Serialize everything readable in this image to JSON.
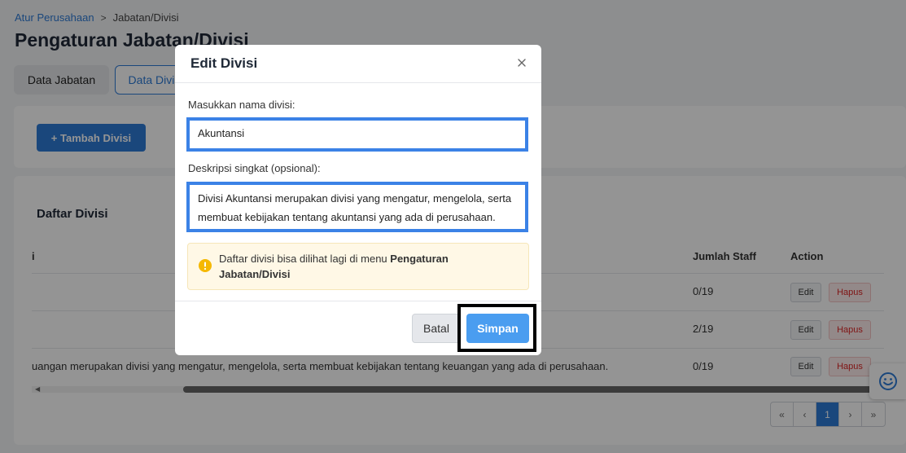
{
  "breadcrumb": {
    "parent": "Atur Perusahaan",
    "separator": ">",
    "current": "Jabatan/Divisi"
  },
  "page_title": "Pengaturan Jabatan/Divisi",
  "tabs": [
    {
      "label": "Data Jabatan"
    },
    {
      "label": "Data Divisi"
    }
  ],
  "add_button": "+ Tambah Divisi",
  "list": {
    "title": "Daftar Divisi",
    "columns": {
      "name": "i",
      "staff": "Jumlah Staff",
      "action": "Action"
    },
    "rows": [
      {
        "desc": "",
        "staff": "0/19",
        "edit": "Edit",
        "delete": "Hapus"
      },
      {
        "desc": "",
        "staff": "2/19",
        "edit": "Edit",
        "delete": "Hapus"
      },
      {
        "desc": "uangan merupakan divisi yang mengatur, mengelola, serta membuat kebijakan tentang keuangan yang ada di perusahaan.",
        "staff": "0/19",
        "edit": "Edit",
        "delete": "Hapus"
      }
    ]
  },
  "pagination": {
    "first": "«",
    "prev": "‹",
    "current": "1",
    "next": "›",
    "last": "»"
  },
  "modal": {
    "title": "Edit Divisi",
    "name_label": "Masukkan nama divisi:",
    "name_value": "Akuntansi",
    "desc_label": "Deskripsi singkat (opsional):",
    "desc_value": "Divisi Akuntansi merupakan divisi yang mengatur, mengelola, serta membuat kebijakan tentang akuntansi yang ada di perusahaan.",
    "info_text": "Daftar divisi bisa dilihat lagi di menu ",
    "info_bold": "Pengaturan Jabatan/Divisi",
    "cancel_label": "Batal",
    "save_label": "Simpan"
  },
  "colors": {
    "primary": "#2e7bd6",
    "highlight": "#3b82e6",
    "info_bg": "#fff8e6",
    "warning_icon": "#f5b800",
    "danger": "#dc2626"
  }
}
